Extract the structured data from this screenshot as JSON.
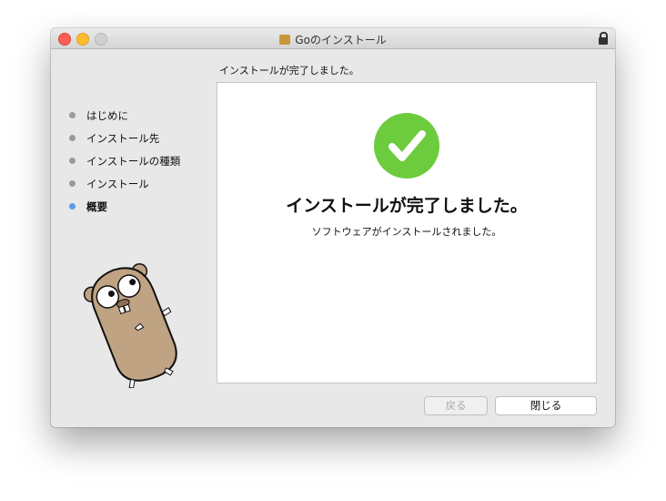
{
  "window": {
    "title": "Goのインストール"
  },
  "heading": "インストールが完了しました。",
  "steps": [
    {
      "label": "はじめに"
    },
    {
      "label": "インストール先"
    },
    {
      "label": "インストールの種類"
    },
    {
      "label": "インストール"
    },
    {
      "label": "概要",
      "active": true
    }
  ],
  "main": {
    "title": "インストールが完了しました。",
    "subtitle": "ソフトウェアがインストールされました。"
  },
  "buttons": {
    "back": "戻る",
    "close": "閉じる"
  },
  "colors": {
    "success": "#6dcb3e",
    "active_step": "#5a9ce8"
  }
}
